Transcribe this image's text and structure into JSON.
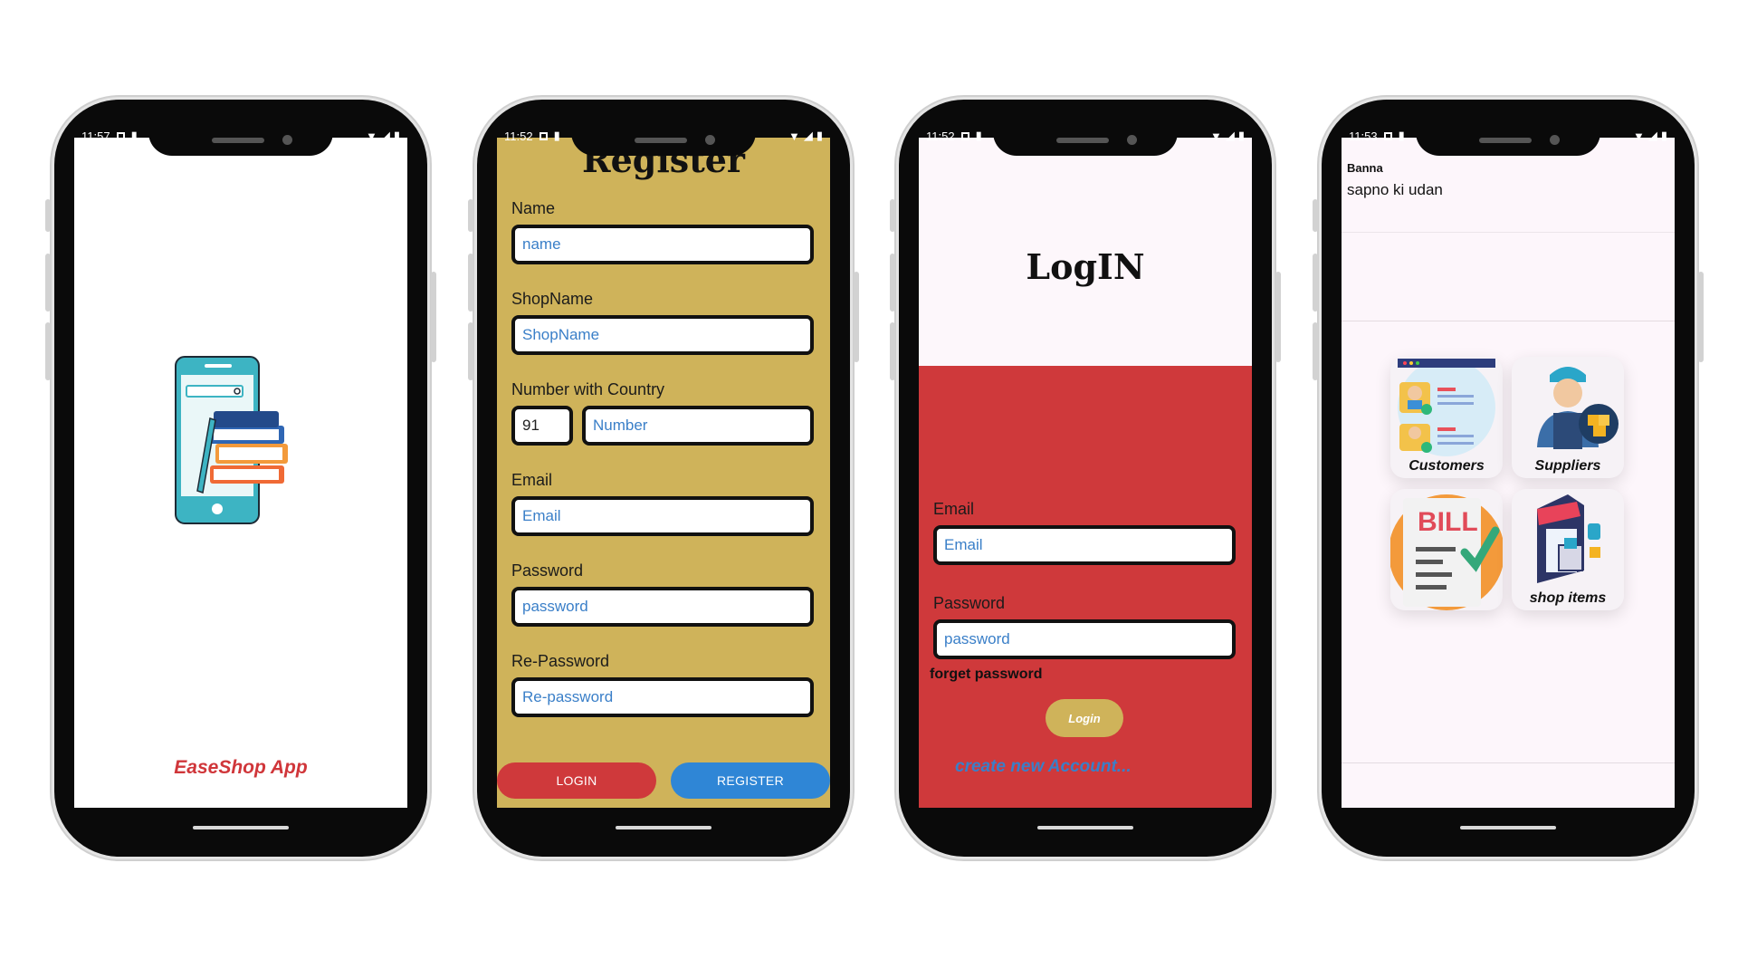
{
  "phones": [
    {
      "time": "11:57",
      "brand": "EaseShop App"
    },
    {
      "time": "11:52",
      "title": "Register",
      "fields": [
        {
          "label": "Name",
          "placeholder": "name"
        },
        {
          "label": "ShopName",
          "placeholder": "ShopName"
        },
        {
          "label": "Number with Country",
          "country_code": "91",
          "placeholder": "Number"
        },
        {
          "label": "Email",
          "placeholder": "Email"
        },
        {
          "label": "Password",
          "placeholder": "password"
        },
        {
          "label": "Re-Password",
          "placeholder": "Re-password"
        }
      ],
      "login_button": "LOGIN",
      "register_button": "REGISTER"
    },
    {
      "time": "11:52",
      "title": "LogIN",
      "email_label": "Email",
      "email_placeholder": "Email",
      "password_label": "Password",
      "password_placeholder": "password",
      "forget": "forget password",
      "login_button": "Login",
      "create_account": "create new Account..."
    },
    {
      "time": "11:53",
      "user_name": "Banna",
      "tagline": "sapno ki udan",
      "tiles": [
        "Customers",
        "Suppliers",
        "",
        "shop items"
      ],
      "bill_text": "BILL"
    }
  ],
  "colors": {
    "register_bg": "#cfb35a",
    "login_red": "#cf393b",
    "brand_red": "#d0363a",
    "link_blue": "#3a7fc8",
    "register_button": "#2f86d6"
  },
  "icons": [
    "wifi-icon",
    "signal-icon",
    "battery-icon",
    "sim-icon",
    "lock-icon"
  ]
}
